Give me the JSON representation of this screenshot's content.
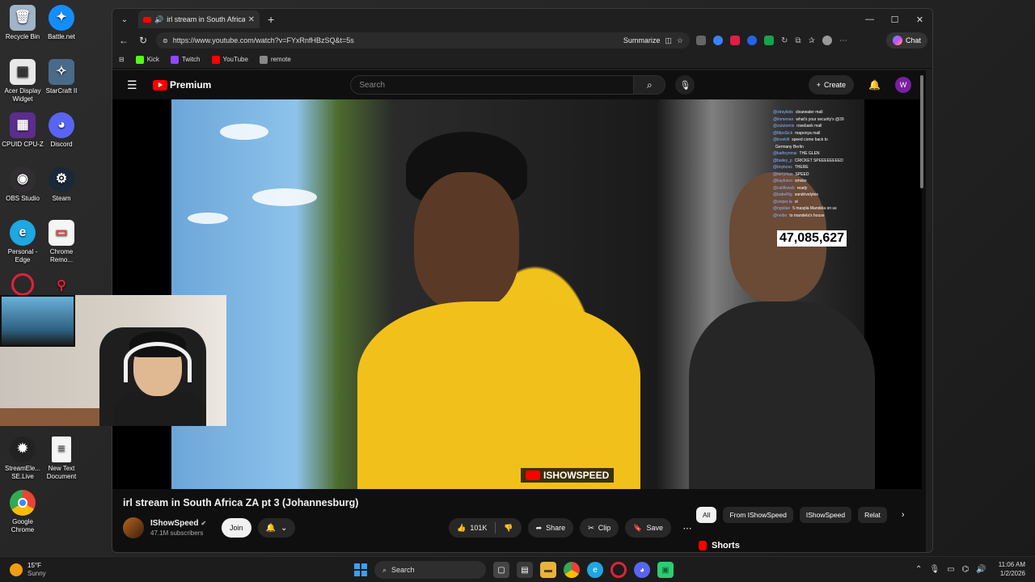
{
  "desktop": {
    "icons": [
      {
        "label": "Recycle Bin",
        "icon": "recycle-bin-icon",
        "color": "#9fb4c8"
      },
      {
        "label": "Battle.net",
        "icon": "battlenet-icon",
        "color": "#148eff"
      },
      {
        "label": "Acer Display Widget",
        "icon": "acer-widget-icon",
        "color": "#e8e8e8"
      },
      {
        "label": "StarCraft II",
        "icon": "starcraft-icon",
        "color": "#4a6a8a"
      },
      {
        "label": "CPUID CPU-Z",
        "icon": "cpuz-icon",
        "color": "#5b2d8e"
      },
      {
        "label": "Discord",
        "icon": "discord-icon",
        "color": "#5865f2"
      },
      {
        "label": "OBS Studio",
        "icon": "obs-icon",
        "color": "#302e31"
      },
      {
        "label": "Steam",
        "icon": "steam-icon",
        "color": "#1b2838"
      },
      {
        "label": "Personal - Edge",
        "icon": "edge-icon",
        "color": "#1ea7e1"
      },
      {
        "label": "Chrome Remo...",
        "icon": "chrome-remote-icon",
        "color": "#e94235"
      },
      {
        "label": "StreamEle... SE.Live",
        "icon": "streamelements-icon",
        "color": "#222"
      },
      {
        "label": "New Text Document",
        "icon": "text-document-icon",
        "color": "#f5f5f5"
      },
      {
        "label": "Google Chrome",
        "icon": "chrome-icon",
        "color": "#34a853"
      }
    ]
  },
  "browser": {
    "tab_title": "irl stream in South Africa ZA pt",
    "url": "https://www.youtube.com/watch?v=FYxRnfHBzSQ&t=5s",
    "summarize_label": "Summarize",
    "chat_label": "Chat",
    "bookmarks": [
      {
        "label": "Kick",
        "color": "#53fc18"
      },
      {
        "label": "Twitch",
        "color": "#9146ff"
      },
      {
        "label": "YouTube",
        "color": "#ff0000"
      },
      {
        "label": "remote",
        "color": "#888888"
      }
    ]
  },
  "youtube": {
    "logo_text": "Premium",
    "search_placeholder": "Search",
    "create_label": "Create",
    "avatar_letter": "W",
    "video_title": "irl stream in South Africa ZA pt 3 (Johannesburg)",
    "channel_name": "IShowSpeed",
    "subscribers": "47.1M subscribers",
    "join_label": "Join",
    "like_count": "101K",
    "share_label": "Share",
    "clip_label": "Clip",
    "save_label": "Save",
    "chips": [
      "All",
      "From IShowSpeed",
      "IShowSpeed",
      "Relat"
    ],
    "shorts_label": "Shorts",
    "overlay": {
      "viewer_count": "47,085,627",
      "watermark": "ISHOWSPEED",
      "chat": [
        {
          "user": "@straykids",
          "msg": "clearwater mall"
        },
        {
          "user": "@itsmenan",
          "msg": "what's your security's @39"
        },
        {
          "user": "@zulutomis",
          "msg": "rosebank mall"
        },
        {
          "user": "@MpoSick",
          "msg": "maponya mall"
        },
        {
          "user": "@lovekill",
          "msg": "speed come back to"
        },
        {
          "user": "",
          "msg": "Germany Berlin"
        },
        {
          "user": "@kathrynmai",
          "msg": "THE GLEN"
        },
        {
          "user": "@bailey_p",
          "msg": "CRICKET SPEEEEEEEED"
        },
        {
          "user": "@boyboss",
          "msg": "THERE"
        },
        {
          "user": "@terrymas",
          "msg": "SPEED"
        },
        {
          "user": "@kaylnero",
          "msg": "smoke"
        },
        {
          "user": "@califlowsb",
          "msg": "ready"
        },
        {
          "user": "@babeRig",
          "msg": "sandrivelytes"
        },
        {
          "user": "@sniper.la",
          "msg": "ol"
        },
        {
          "user": "@ngolian",
          "msg": "5 maspla Mandela on us"
        },
        {
          "user": "@neibo",
          "msg": "to mandela's house"
        }
      ]
    }
  },
  "taskbar": {
    "temperature": "15°F",
    "weather": "Sunny",
    "search_placeholder": "Search",
    "time": "11:06 AM",
    "date": "1/2/2026"
  }
}
